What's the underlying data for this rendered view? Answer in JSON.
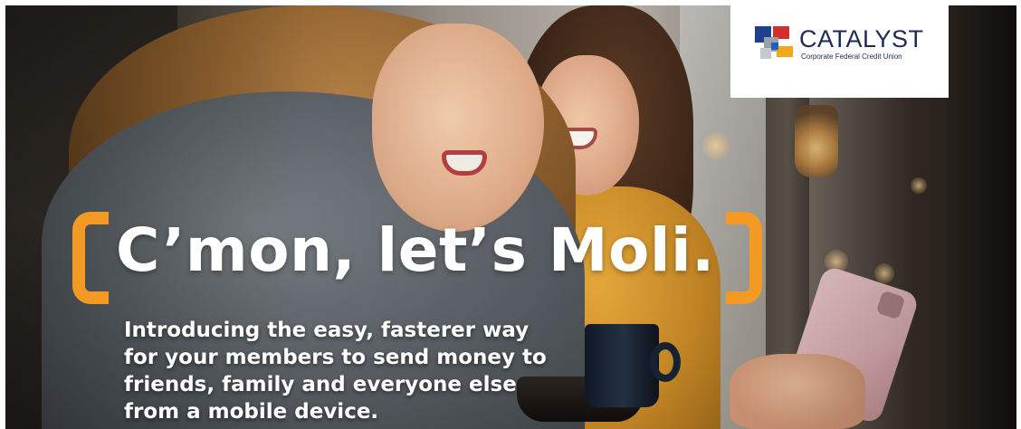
{
  "logo": {
    "name": "CATALYST",
    "subtitle": "Corporate Federal Credit Union",
    "colors": {
      "navy": "#1d2a58",
      "blue": "#1f5fbf",
      "red": "#d42e2b",
      "gray": "#9aa0a8",
      "gold": "#f3a81c"
    }
  },
  "headline": {
    "text": "C’mon, let’s Moli.",
    "bracket_color": "#f39a24"
  },
  "body": {
    "lines": [
      "Introducing the easy, fasterer way",
      "for your members to send money to",
      "friends, family and everyone else",
      "from a mobile device."
    ]
  }
}
